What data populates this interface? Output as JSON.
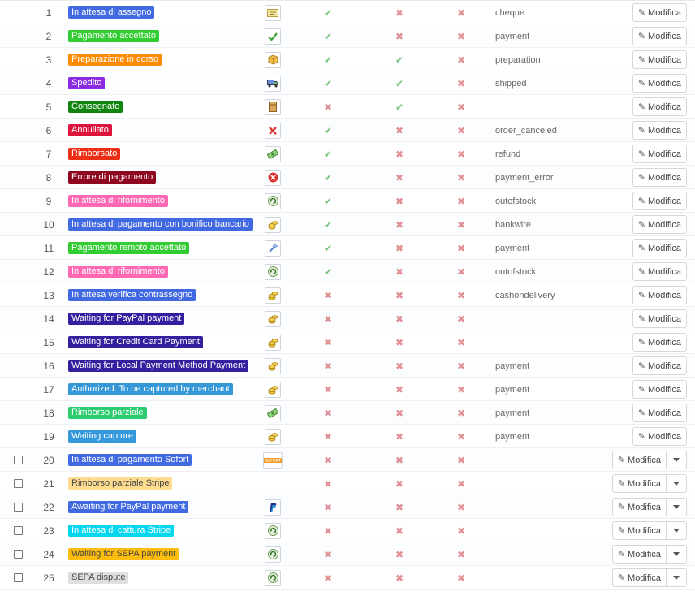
{
  "action_label": "Modifica",
  "statuses": [
    {
      "id": "1",
      "name": "In attesa di assegno",
      "color": "#4169e1",
      "icon": "cheque-icon",
      "send": true,
      "delivery": false,
      "invoice": false,
      "template": "cheque",
      "checkbox": false
    },
    {
      "id": "2",
      "name": "Pagamento accettato",
      "color": "#32cd32",
      "icon": "check-icon",
      "send": true,
      "delivery": false,
      "invoice": false,
      "template": "payment",
      "checkbox": false
    },
    {
      "id": "3",
      "name": "Preparazione in corso",
      "color": "#ff8c00",
      "icon": "box-icon",
      "send": true,
      "delivery": true,
      "invoice": false,
      "template": "preparation",
      "checkbox": false
    },
    {
      "id": "4",
      "name": "Spedito",
      "color": "#8a2be2",
      "icon": "truck-icon",
      "send": true,
      "delivery": true,
      "invoice": false,
      "template": "shipped",
      "checkbox": false
    },
    {
      "id": "5",
      "name": "Consegnato",
      "color": "#108510",
      "icon": "package-icon",
      "send": false,
      "delivery": true,
      "invoice": false,
      "template": "",
      "checkbox": false
    },
    {
      "id": "6",
      "name": "Annullato",
      "color": "#dc143c",
      "icon": "cross-icon",
      "send": true,
      "delivery": false,
      "invoice": false,
      "template": "order_canceled",
      "checkbox": false
    },
    {
      "id": "7",
      "name": "Rimborsato",
      "color": "#ec2e15",
      "icon": "money-icon",
      "send": true,
      "delivery": false,
      "invoice": false,
      "template": "refund",
      "checkbox": false
    },
    {
      "id": "8",
      "name": "Errore di pagamento",
      "color": "#8f0621",
      "icon": "error-icon",
      "send": true,
      "delivery": false,
      "invoice": false,
      "template": "payment_error",
      "checkbox": false
    },
    {
      "id": "9",
      "name": "In attesa di rifornimento",
      "color": "#ff69b4",
      "icon": "refresh-icon",
      "send": true,
      "delivery": false,
      "invoice": false,
      "template": "outofstock",
      "checkbox": false
    },
    {
      "id": "10",
      "name": "In attesa di pagamento con bonifico bancario",
      "color": "#4169e1",
      "icon": "coins-icon",
      "send": true,
      "delivery": false,
      "invoice": false,
      "template": "bankwire",
      "checkbox": false
    },
    {
      "id": "11",
      "name": "Pagamento remoto accettato",
      "color": "#32cd32",
      "icon": "wand-icon",
      "send": true,
      "delivery": false,
      "invoice": false,
      "template": "payment",
      "checkbox": false
    },
    {
      "id": "12",
      "name": "In attesa di rifornimento",
      "color": "#ff69b4",
      "icon": "refresh-icon",
      "send": true,
      "delivery": false,
      "invoice": false,
      "template": "outofstock",
      "checkbox": false
    },
    {
      "id": "13",
      "name": "In attesa verifica contrassegno",
      "color": "#4169e1",
      "icon": "coins-icon",
      "send": false,
      "delivery": false,
      "invoice": false,
      "template": "cashondelivery",
      "checkbox": false
    },
    {
      "id": "14",
      "name": "Waiting for PayPal payment",
      "color": "#34209e",
      "icon": "coins-icon",
      "send": false,
      "delivery": false,
      "invoice": false,
      "template": "",
      "checkbox": false
    },
    {
      "id": "15",
      "name": "Waiting for Credit Card Payment",
      "color": "#34209e",
      "icon": "coins-icon",
      "send": false,
      "delivery": false,
      "invoice": false,
      "template": "",
      "checkbox": false
    },
    {
      "id": "16",
      "name": "Waiting for Local Payment Method Payment",
      "color": "#34209e",
      "icon": "coins-icon",
      "send": false,
      "delivery": false,
      "invoice": false,
      "template": "payment",
      "checkbox": false
    },
    {
      "id": "17",
      "name": "Authorized. To be captured by merchant",
      "color": "#3498d8",
      "icon": "coins-icon",
      "send": false,
      "delivery": false,
      "invoice": false,
      "template": "payment",
      "checkbox": false
    },
    {
      "id": "18",
      "name": "Rimborso parziale",
      "color": "#2ecc71",
      "icon": "money-icon",
      "send": false,
      "delivery": false,
      "invoice": false,
      "template": "payment",
      "checkbox": false
    },
    {
      "id": "19",
      "name": "Waiting capture",
      "color": "#3498db",
      "icon": "coins-icon",
      "send": false,
      "delivery": false,
      "invoice": false,
      "template": "payment",
      "checkbox": false
    },
    {
      "id": "20",
      "name": "In attesa di pagamento Sofort",
      "color": "#4169e1",
      "icon": "sofort-logo-icon",
      "send": false,
      "delivery": false,
      "invoice": false,
      "template": "",
      "checkbox": true
    },
    {
      "id": "21",
      "name": "Rimborso parziale Stripe",
      "color": "#fedc90",
      "text_dark": true,
      "icon": "",
      "send": false,
      "delivery": false,
      "invoice": false,
      "template": "",
      "checkbox": true
    },
    {
      "id": "22",
      "name": "Awaiting for PayPal payment",
      "color": "#4169e1",
      "icon": "paypal-icon",
      "send": false,
      "delivery": false,
      "invoice": false,
      "template": "",
      "checkbox": true
    },
    {
      "id": "23",
      "name": "In attesa di cattura Stripe",
      "color": "#00d6ef",
      "icon": "refresh-icon",
      "send": false,
      "delivery": false,
      "invoice": false,
      "template": "",
      "checkbox": true
    },
    {
      "id": "24",
      "name": "Waiting for SEPA payment",
      "color": "#fcbd0e",
      "text_dark": true,
      "icon": "refresh-icon",
      "send": false,
      "delivery": false,
      "invoice": false,
      "template": "",
      "checkbox": true
    },
    {
      "id": "25",
      "name": "SEPA dispute",
      "color": "#e0e0e0",
      "text_dark": true,
      "icon": "refresh-icon",
      "send": false,
      "delivery": false,
      "invoice": false,
      "template": "",
      "checkbox": true
    }
  ]
}
